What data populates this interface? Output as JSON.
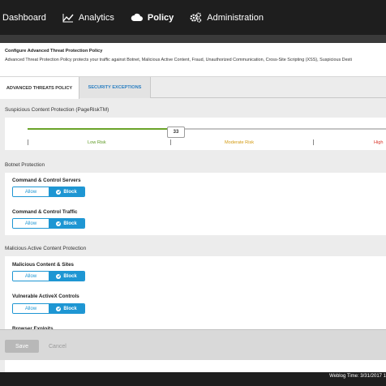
{
  "nav": {
    "items": [
      {
        "label": "Dashboard",
        "icon": "none"
      },
      {
        "label": "Analytics",
        "icon": "line-chart-icon"
      },
      {
        "label": "Policy",
        "icon": "cloud-icon"
      },
      {
        "label": "Administration",
        "icon": "gears-icon"
      }
    ],
    "active": "Policy"
  },
  "header": {
    "title": "Configure Advanced Threat Protection Policy",
    "description": "Advanced Threat Protection Policy protects your traffic against Botnet, Malicious Active Content, Fraud, Unauthorized Communication, Cross-Site Scripting (XSS), Suspicious Desti"
  },
  "tabs": [
    {
      "label": "ADVANCED THREATS POLICY",
      "active": true
    },
    {
      "label": "SECURITY EXCEPTIONS",
      "active": false
    }
  ],
  "suspicious": {
    "title": "Suspicious Content Protection (PageRiskTM)",
    "value": "33",
    "level_fraction": 0.39,
    "low_label": "Low Risk",
    "moderate_label": "Moderate Risk",
    "high_label": "High"
  },
  "botnet": {
    "title": "Botnet Protection",
    "controls": [
      {
        "label": "Command & Control Servers",
        "allow": "Allow",
        "block": "Block",
        "selected": "Block"
      },
      {
        "label": "Command & Control Traffic",
        "allow": "Allow",
        "block": "Block",
        "selected": "Block"
      }
    ]
  },
  "malicious": {
    "title": "Malicious Active Content Protection",
    "controls": [
      {
        "label": "Malicious Content & Sites",
        "allow": "Allow",
        "block": "Block",
        "selected": "Block"
      },
      {
        "label": "Vulnerable ActiveX Controls",
        "allow": "Allow",
        "block": "Block",
        "selected": "Block"
      },
      {
        "label": "Browser Exploits"
      }
    ]
  },
  "footer": {
    "save_label": "Save",
    "cancel_label": "Cancel"
  },
  "status": {
    "weblog_time": "Weblog Time: 3/31/2017 1"
  },
  "colors": {
    "accent_blue": "#1e96d3",
    "slider_green": "#6aa329",
    "low_risk": "#5e9a25",
    "moderate_risk": "#d39a12",
    "high_risk": "#d9362b"
  }
}
